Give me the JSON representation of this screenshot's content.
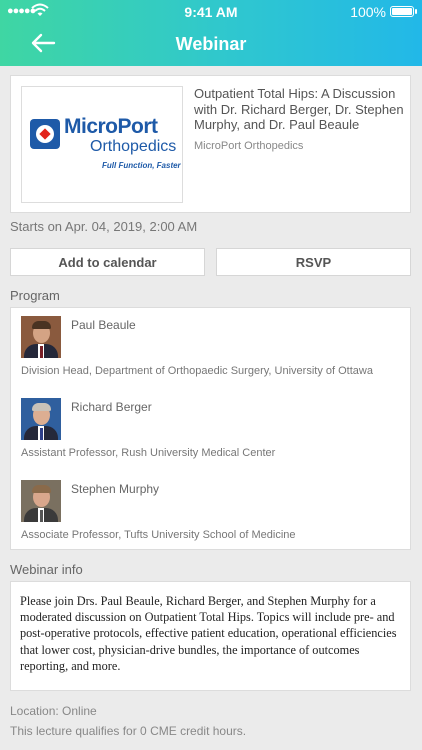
{
  "status_bar": {
    "time": "9:41 AM",
    "battery": "100%"
  },
  "header": {
    "title": "Webinar"
  },
  "event": {
    "logo": {
      "brand": "MicroPort",
      "sub": "Orthopedics",
      "tagline": "Full Function, Faster"
    },
    "title": "Outpatient Total Hips: A Discussion with Dr. Richard Berger, Dr. Stephen Murphy, and Dr. Paul Beaule",
    "organizer": "MicroPort Orthopedics",
    "starts": "Starts on Apr. 04, 2019,  2:00 AM"
  },
  "actions": {
    "add_calendar": "Add to calendar",
    "rsvp": "RSVP"
  },
  "program": {
    "label": "Program",
    "speakers": [
      {
        "name": "Paul Beaule",
        "role": "Division Head, Department of Orthopaedic Surgery, University of Ottawa"
      },
      {
        "name": "Richard Berger",
        "role": "Assistant Professor, Rush University Medical Center"
      },
      {
        "name": "Stephen Murphy",
        "role": "Associate Professor, Tufts University School of Medicine"
      }
    ]
  },
  "info": {
    "label": "Webinar info",
    "text": "Please join Drs. Paul Beaule, Richard Berger, and Stephen Murphy for a moderated discussion on Outpatient Total Hips. Topics will include pre- and post-operative protocols, effective patient education, operational efficiencies that lower cost, physician-drive bundles, the importance of outcomes reporting, and more."
  },
  "location": "Location: Online",
  "cme": "This lecture qualifies for 0 CME credit hours.",
  "colors": {
    "header_start": "#3fd6a3",
    "header_end": "#22b8e8",
    "brand_blue": "#1e5aa8"
  },
  "icons": [
    "signal-icon",
    "wifi-icon",
    "battery-icon",
    "back-arrow-icon"
  ]
}
